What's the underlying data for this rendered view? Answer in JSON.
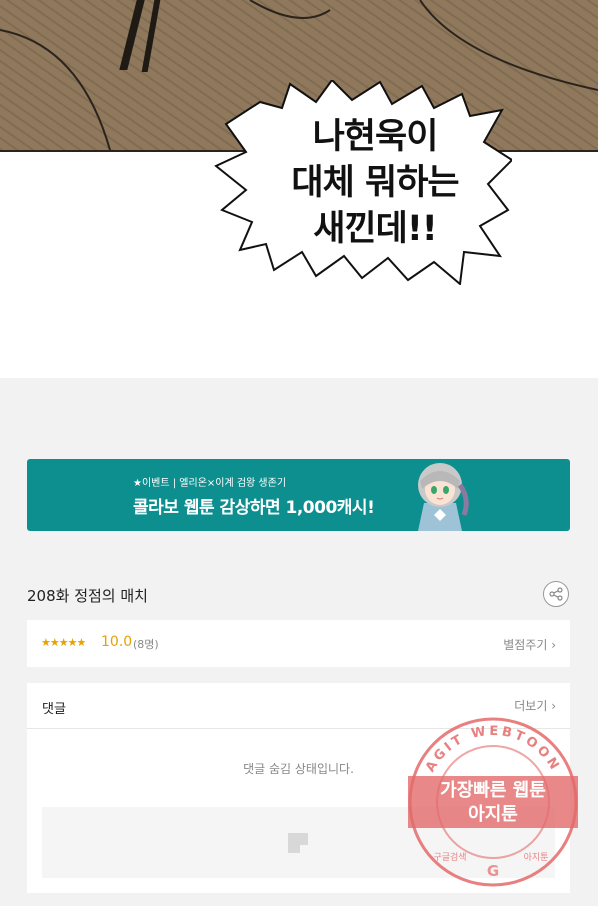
{
  "comic": {
    "speech_lines": [
      "나현욱이",
      "대체 뭐하는",
      "새낀데!!"
    ]
  },
  "banner": {
    "event_text": "★이벤트 | 엘리온×이계 검왕 생존기",
    "headline": "콜라보 웹툰 감상하면 1,000캐시!",
    "background": "#0d8f8f"
  },
  "episode": {
    "title": "208화 정점의 매치",
    "share_icon": "share-icon"
  },
  "rating": {
    "stars": "★★★★★",
    "score": "10.0",
    "count": "(8명)",
    "rate_label": "별점주기 ›",
    "accent": "#e8a200"
  },
  "comments": {
    "title": "댓글",
    "more_label": "더보기 ›",
    "hidden_message": "댓글 숨김 상태입니다."
  },
  "watermark": {
    "ring_text": "AGIT WEBTOON",
    "line1": "가장빠른 웹툰",
    "line2": "아지툰",
    "bottom_left": "구글검색",
    "bottom_right": "아지툰",
    "color": "#e46a6a"
  }
}
